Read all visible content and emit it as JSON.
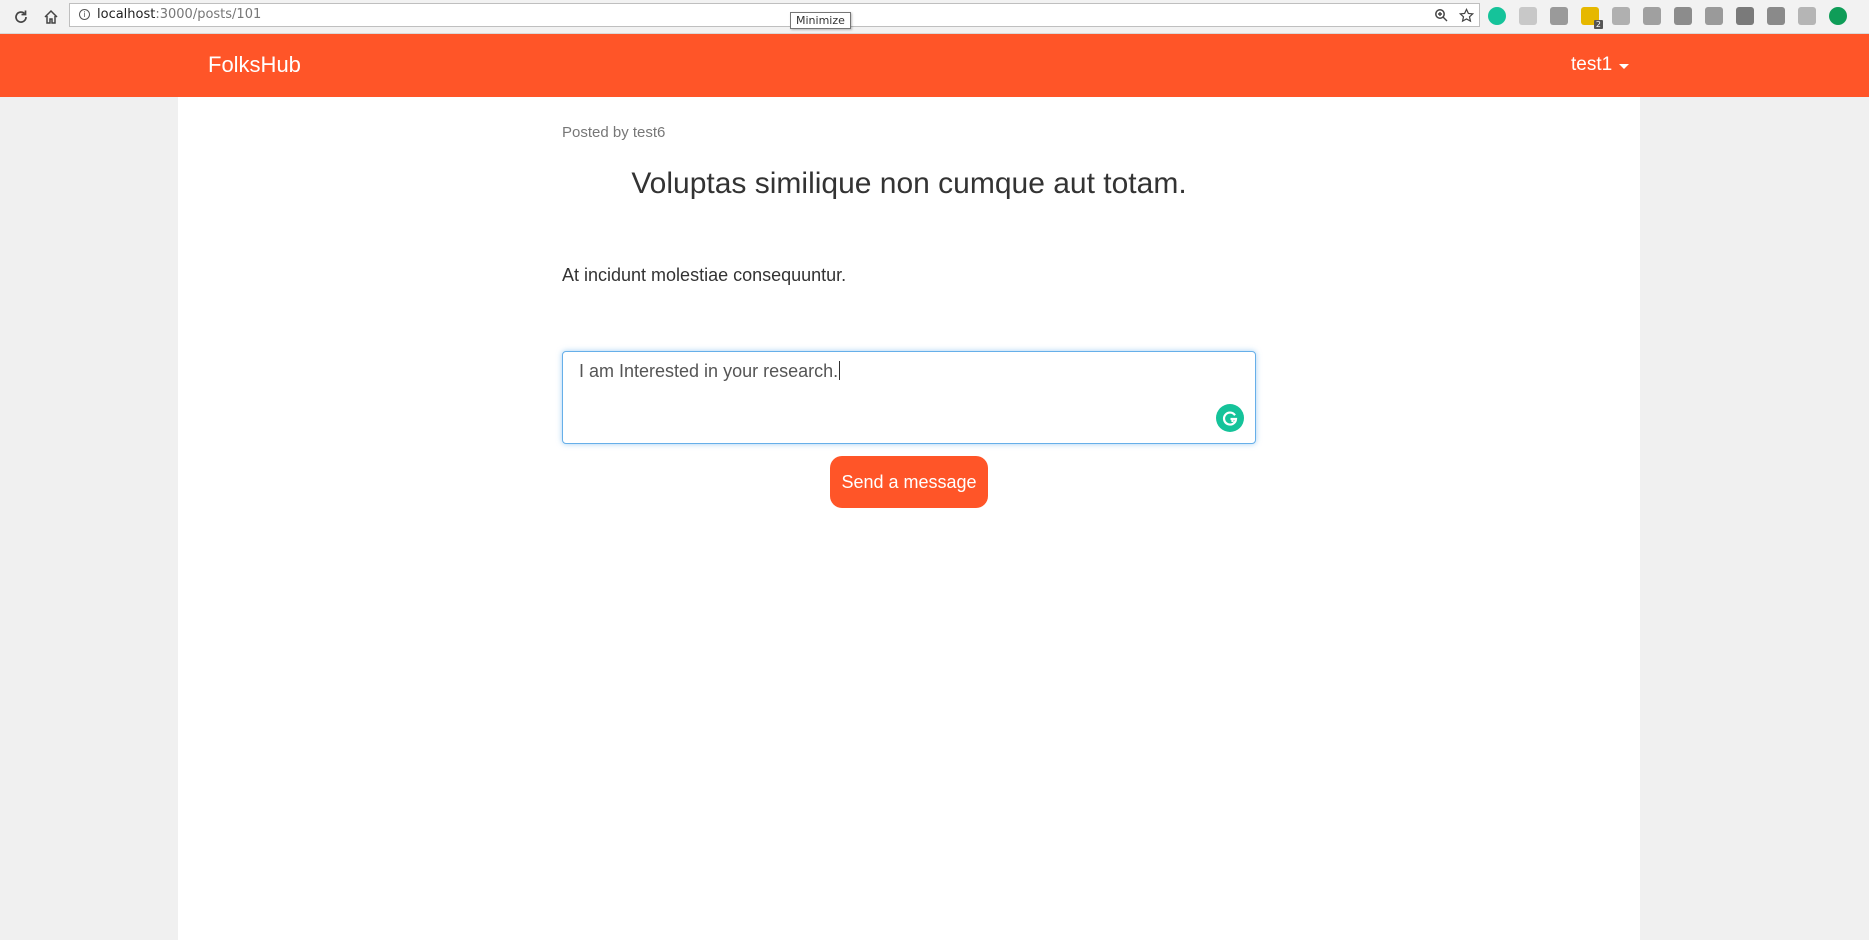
{
  "browser": {
    "url_host": "localhost",
    "url_rest": ":3000/posts/101",
    "tooltip": "Minimize",
    "extensions": [
      {
        "name": "grammarly-ext-icon",
        "color": "#15c39a"
      },
      {
        "name": "ext-icon-2",
        "color": "#c8c8c8"
      },
      {
        "name": "ext-icon-3",
        "color": "#9a9a9a"
      },
      {
        "name": "ext-icon-4",
        "color": "#e6b800",
        "badge": "2"
      },
      {
        "name": "ext-icon-5",
        "color": "#b0b0b0"
      },
      {
        "name": "ext-icon-6",
        "color": "#a0a0a0"
      },
      {
        "name": "ext-icon-7",
        "color": "#8c8c8c"
      },
      {
        "name": "ext-icon-8",
        "color": "#9a9a9a"
      },
      {
        "name": "ext-icon-9",
        "color": "#7a7a7a"
      },
      {
        "name": "ext-icon-10",
        "color": "#8a8a8a"
      },
      {
        "name": "ext-icon-11",
        "color": "#b5b5b5"
      },
      {
        "name": "update-icon",
        "color": "#0f9d58"
      }
    ]
  },
  "header": {
    "brand": "FolksHub",
    "user": "test1",
    "color": "#ff5528"
  },
  "post": {
    "posted_by": "Posted by test6",
    "title": "Voluptas similique non cumque aut totam.",
    "body": "At incidunt molestiae consequuntur."
  },
  "message": {
    "value": "I am Interested in your research."
  },
  "actions": {
    "send_label": "Send a message"
  }
}
